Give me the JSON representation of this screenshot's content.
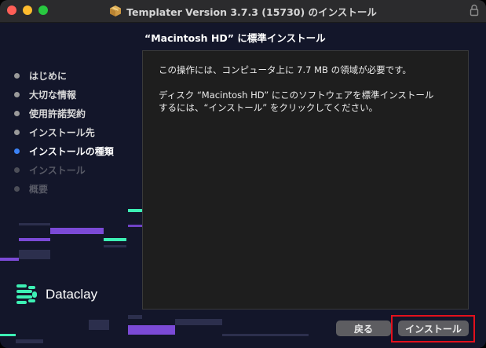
{
  "window": {
    "title": "Templater Version 3.7.3 (15730) のインストール"
  },
  "header": {
    "text": "“Macintosh HD” に標準インストール"
  },
  "sidebar": {
    "steps": [
      {
        "label": "はじめに",
        "state": "done"
      },
      {
        "label": "大切な情報",
        "state": "done"
      },
      {
        "label": "使用許諾契約",
        "state": "done"
      },
      {
        "label": "インストール先",
        "state": "done"
      },
      {
        "label": "インストールの種類",
        "state": "current"
      },
      {
        "label": "インストール",
        "state": "future"
      },
      {
        "label": "概要",
        "state": "future"
      }
    ]
  },
  "content": {
    "line1": "この操作には、コンピュータ上に 7.7 MB の領域が必要です。",
    "line2": "ディスク “Macintosh HD” にこのソフトウェアを標準インストール\nするには、“インストール” をクリックしてください。"
  },
  "brand": {
    "name": "Dataclay",
    "logo_icon": "dataclay-logo-icon"
  },
  "buttons": {
    "back_label": "戻る",
    "install_label": "インストール"
  },
  "colors": {
    "window_bg": "#13162a",
    "accent_green": "#3df0b4",
    "accent_purple": "#7b4ad6",
    "current_step_dot": "#3b82f6",
    "highlight_border": "#e3101c"
  }
}
